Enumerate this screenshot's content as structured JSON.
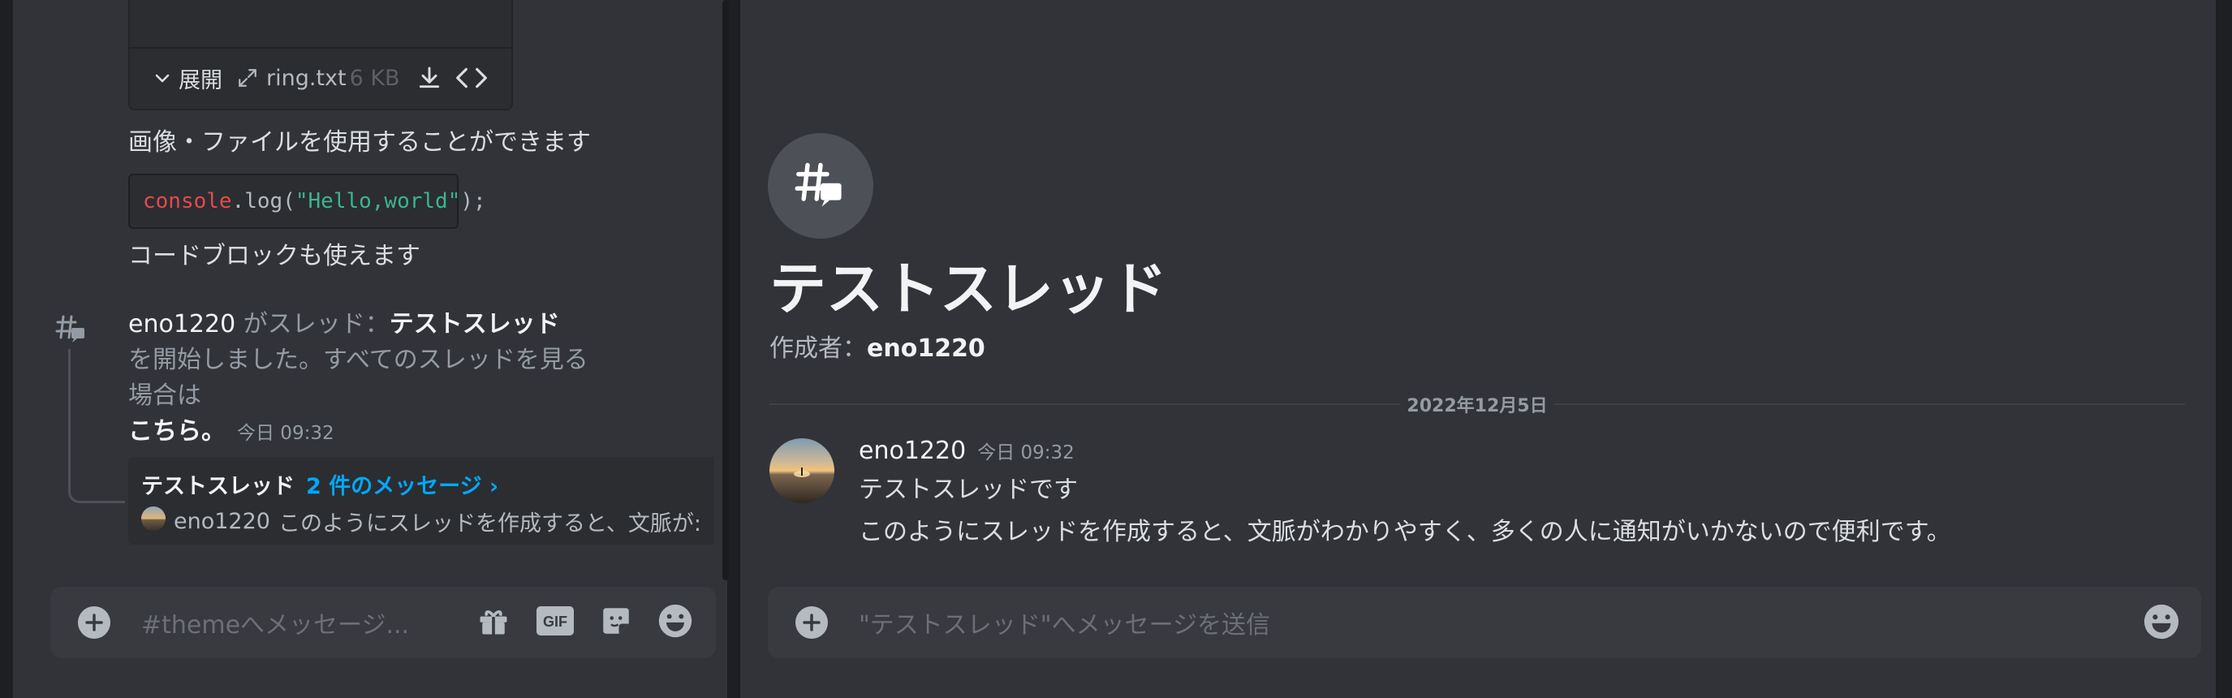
{
  "left_channel": {
    "attachment": {
      "expand_label": "展開",
      "file_name": "ring.txt",
      "file_size": "6 KB"
    },
    "text_image_files": "画像・ファイルを使用することができます",
    "code": {
      "fn": "console",
      "method": ".log(",
      "string": "\"Hello,world\"",
      "end": ");"
    },
    "text_codeblock": "コードブロックも使えます",
    "system_message": {
      "user": "eno1220",
      "part1": " がスレッド：",
      "thread_name": "テストスレッド",
      "part2": " を開始しました。すべてのスレッドを見る",
      "part3": "場合は",
      "link": "こちら。",
      "timestamp": "今日 09:32"
    },
    "thread_card": {
      "name": "テストスレッド",
      "count": "2 件のメッセージ ›",
      "preview_user": "eno1220",
      "preview_text": "このようにスレッドを作成すると、文脈が:"
    },
    "composer": {
      "placeholder": "#themeへメッセージ..."
    }
  },
  "thread_view": {
    "title": "テストスレッド",
    "author_label": "作成者：",
    "author_name": "eno1220",
    "date_divider": "2022年12月5日",
    "message": {
      "author": "eno1220",
      "timestamp": "今日 09:32",
      "line1": "テストスレッドです",
      "line2": "このようにスレッドを作成すると、文脈がわかりやすく、多くの人に通知がいかないので便利です。"
    },
    "composer": {
      "placeholder": "\"テストスレッド\"へメッセージを送信"
    }
  },
  "colors": {
    "background": "#313338",
    "composer": "#383a40",
    "link_blue": "#00a8fc",
    "code_red": "#e34b4b",
    "code_green": "#3bb58f"
  }
}
